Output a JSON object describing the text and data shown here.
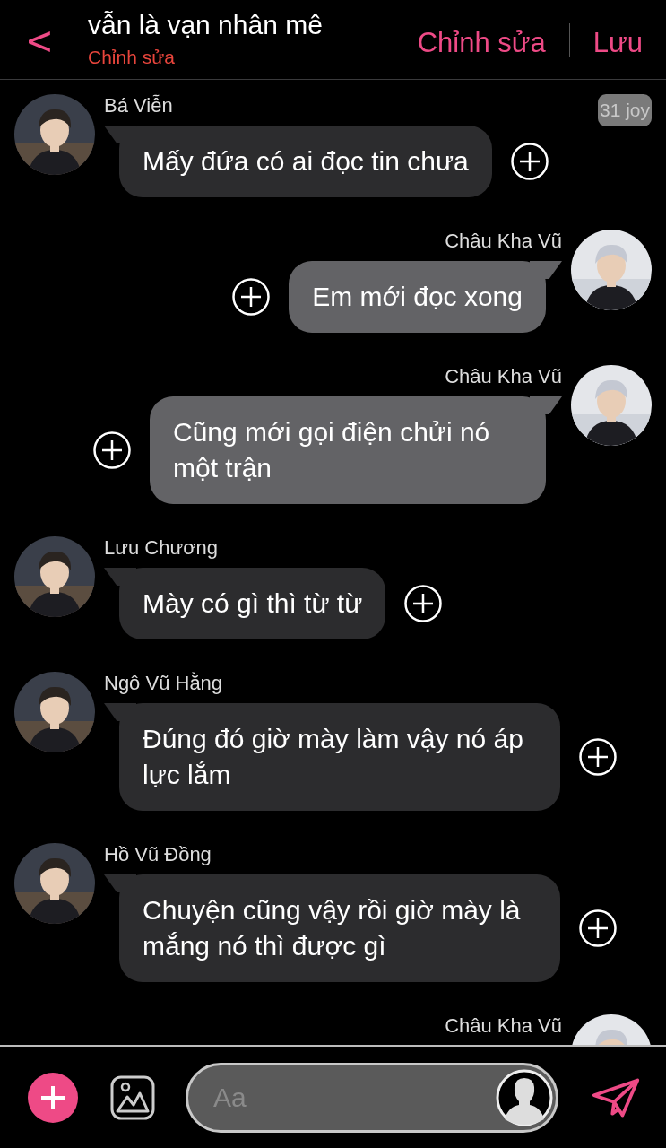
{
  "header": {
    "back": "<",
    "title": "vẫn là vạn nhân mê",
    "subtitle": "Chỉnh sửa",
    "actions": [
      "Chỉnh sửa",
      "Lưu"
    ]
  },
  "badge": "31 joy",
  "messages": [
    {
      "kind": "left",
      "name": "Bá Viễn",
      "text": "Mấy đứa có ai đọc tin chưa"
    },
    {
      "kind": "right",
      "name": "Châu Kha Vũ",
      "text": "Em mới đọc xong"
    },
    {
      "kind": "right",
      "name": "Châu Kha Vũ",
      "text": "Cũng mới gọi điện chửi nó một trận"
    },
    {
      "kind": "left",
      "name": "Lưu Chương",
      "text": "Mày có gì thì từ từ"
    },
    {
      "kind": "left",
      "name": "Ngô Vũ Hằng",
      "text": "Đúng đó giờ mày làm vậy nó áp lực lắm"
    },
    {
      "kind": "left",
      "name": "Hồ Vũ Đồng",
      "text": "Chuyện cũng vậy rồi giờ mày là mắng nó thì được gì"
    },
    {
      "kind": "right",
      "name": "Châu Kha Vũ"
    }
  ],
  "composer": {
    "placeholder": "Aa"
  }
}
